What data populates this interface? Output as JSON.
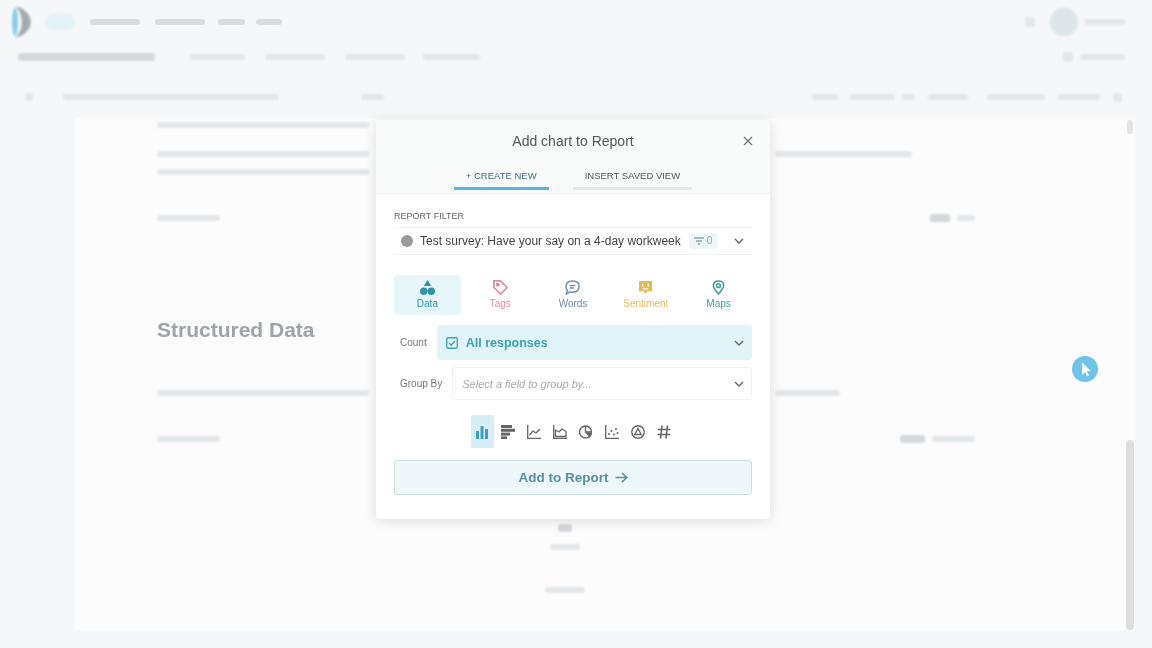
{
  "background": {
    "heading": "Structured Data"
  },
  "dialog": {
    "title": "Add chart to Report",
    "tabs": [
      {
        "label": "+ CREATE NEW",
        "selected": true
      },
      {
        "label": "INSERT SAVED VIEW",
        "selected": false
      }
    ],
    "report_filter": {
      "label": "REPORT FILTER",
      "survey": "Test survey: Have your say on a 4-day workweek",
      "filter_count": "0"
    },
    "analysis_types": [
      {
        "kind": "data",
        "label": "Data",
        "color": "#2f95a8",
        "selected": true
      },
      {
        "kind": "tags",
        "label": "Tags",
        "color": "#d98f9f",
        "selected": false
      },
      {
        "kind": "words",
        "label": "Words",
        "color": "#6d8aa6",
        "selected": false
      },
      {
        "kind": "sentiment",
        "label": "Sentiment",
        "color": "#e3bd55",
        "selected": false
      },
      {
        "kind": "maps",
        "label": "Maps",
        "color": "#3f9f9a",
        "selected": false
      }
    ],
    "count": {
      "label": "Count",
      "value": "All responses"
    },
    "group_by": {
      "label": "Group By",
      "placeholder": "Select a field to group by..."
    },
    "chart_types": [
      {
        "kind": "column",
        "selected": true
      },
      {
        "kind": "bar",
        "selected": false
      },
      {
        "kind": "line",
        "selected": false
      },
      {
        "kind": "area",
        "selected": false
      },
      {
        "kind": "pie",
        "selected": false
      },
      {
        "kind": "scatter",
        "selected": false
      },
      {
        "kind": "circle",
        "selected": false
      },
      {
        "kind": "number",
        "selected": false
      }
    ],
    "submit": {
      "label": "Add to Report"
    }
  }
}
